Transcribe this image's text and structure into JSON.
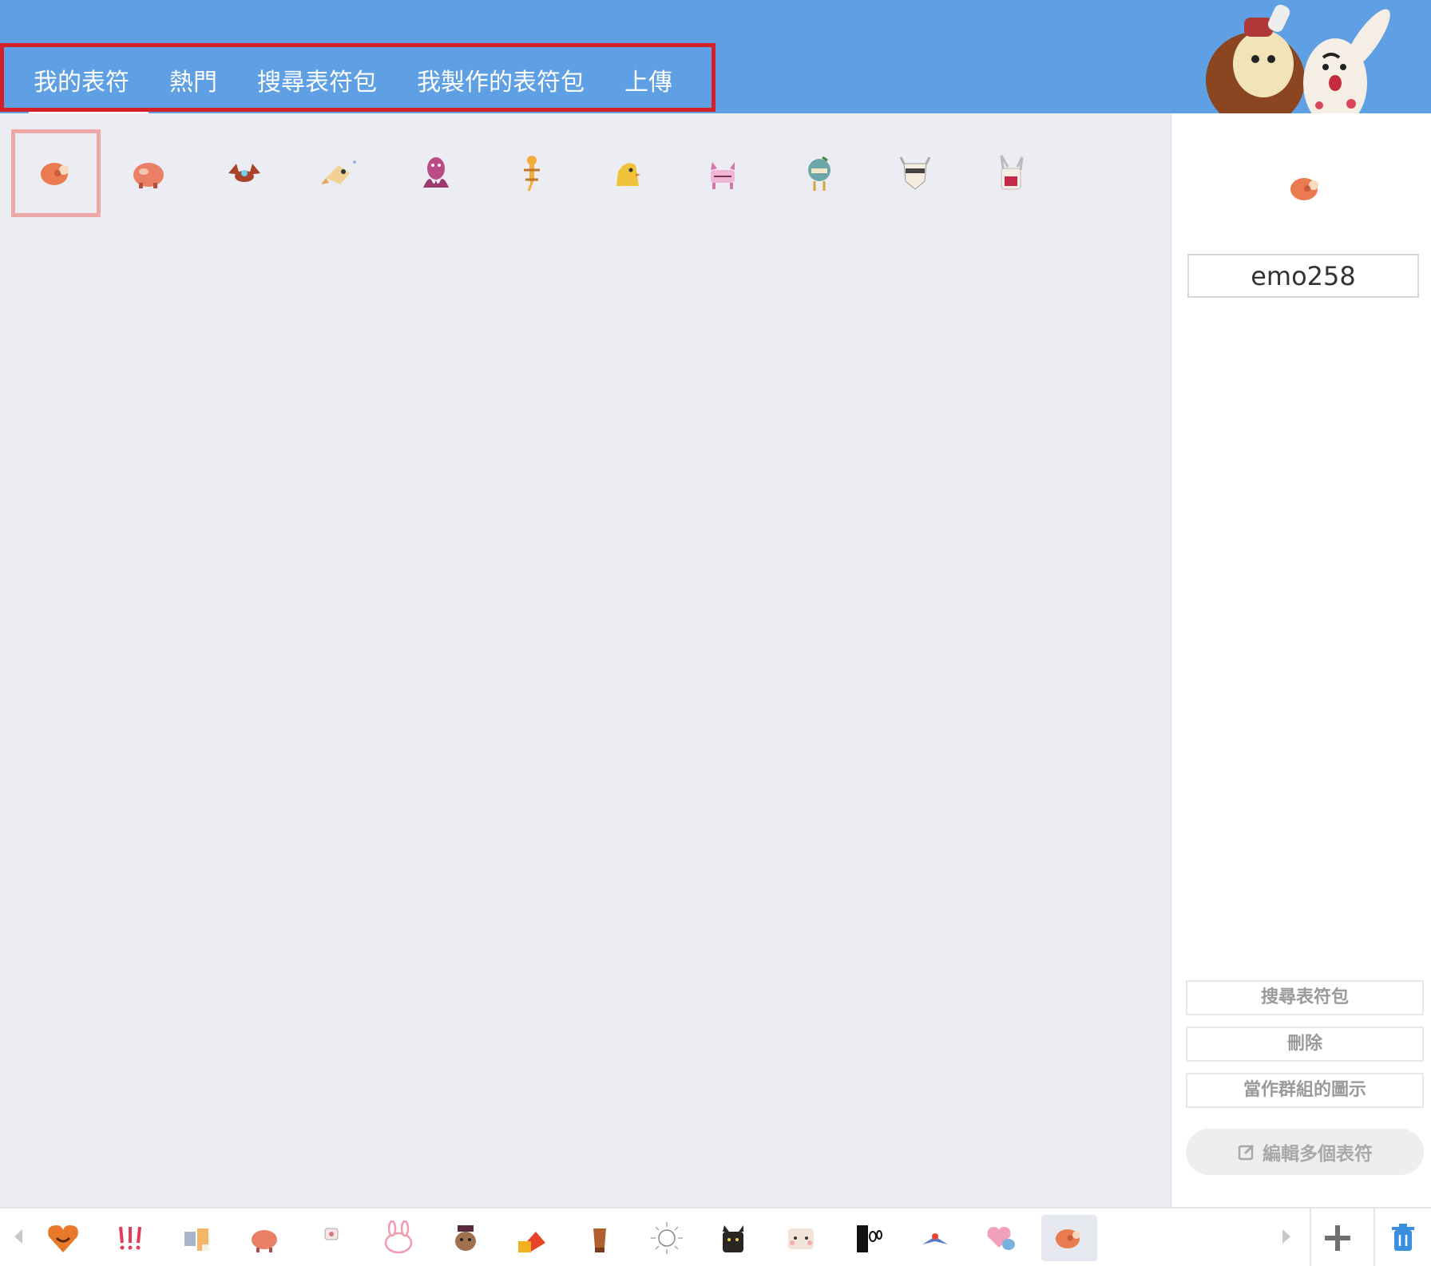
{
  "header": {
    "tabs": [
      {
        "label": "我的表符",
        "active": true
      },
      {
        "label": "熱門",
        "active": false
      },
      {
        "label": "搜尋表符包",
        "active": false
      },
      {
        "label": "我製作的表符包",
        "active": false
      },
      {
        "label": "上傳",
        "active": false
      }
    ],
    "colors": {
      "bar": "#5ea0e3",
      "highlight_box": "#d42027"
    }
  },
  "emoji_grid": {
    "items": [
      {
        "icon": "meat-icon",
        "selected": true
      },
      {
        "icon": "pig-icon",
        "selected": false
      },
      {
        "icon": "crab-icon",
        "selected": false
      },
      {
        "icon": "fish-icon",
        "selected": false
      },
      {
        "icon": "octopus-icon",
        "selected": false
      },
      {
        "icon": "lizard-icon",
        "selected": false
      },
      {
        "icon": "chick-icon",
        "selected": false
      },
      {
        "icon": "cat-icon",
        "selected": false
      },
      {
        "icon": "bird-icon",
        "selected": false
      },
      {
        "icon": "ghost-icon",
        "selected": false
      },
      {
        "icon": "rabbit-icon",
        "selected": false
      }
    ]
  },
  "side_panel": {
    "preview_icon": "meat-icon",
    "name_value": "emo258",
    "buttons": {
      "search_pack": "搜尋表符包",
      "delete": "刪除",
      "set_group_icon": "當作群組的圖示",
      "edit_multiple": "編輯多個表符"
    }
  },
  "bottom_bar": {
    "packs": [
      "heart-face-icon",
      "exclaim-icon",
      "horse-icon",
      "pig-icon",
      "speech-icon",
      "bunny-icon",
      "deer-icon",
      "flag-icon",
      "hand-icon",
      "burst-icon",
      "black-cat-icon",
      "bear-icon",
      "face-icon",
      "bird-fly-icon",
      "heart-bird-icon",
      "meat-icon"
    ],
    "active_index": 15
  }
}
